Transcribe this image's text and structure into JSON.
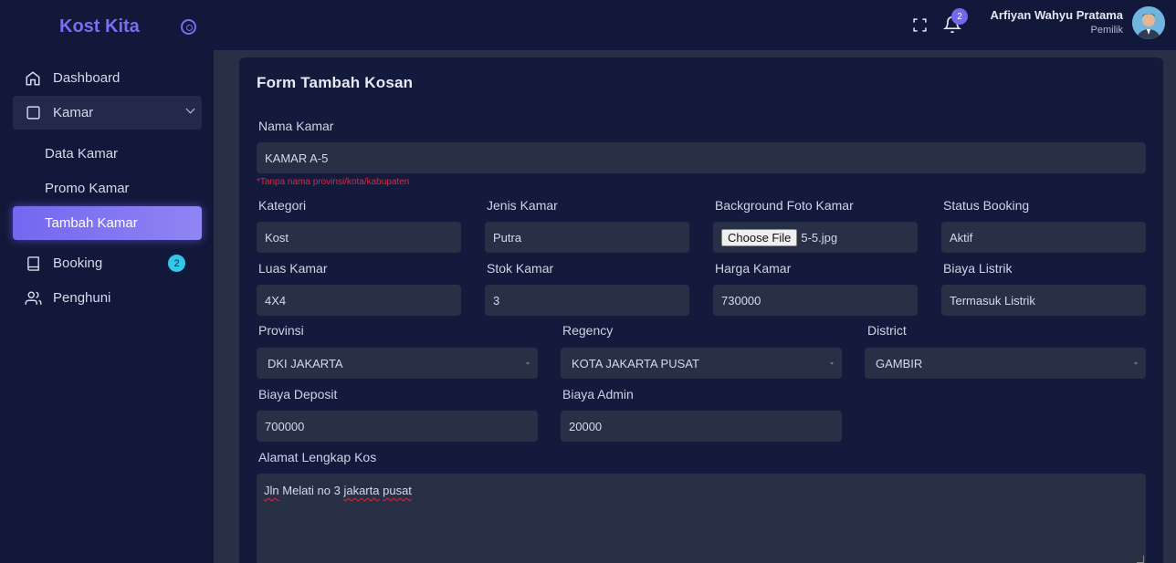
{
  "brand": {
    "name": "Kost Kita"
  },
  "sidebar": {
    "items": [
      {
        "label": "Dashboard",
        "icon": "home-icon"
      },
      {
        "label": "Kamar",
        "icon": "square-icon"
      },
      {
        "label": "Data Kamar"
      },
      {
        "label": "Promo Kamar"
      },
      {
        "label": "Tambah Kamar"
      },
      {
        "label": "Booking",
        "icon": "book-icon",
        "badge": "2"
      },
      {
        "label": "Penghuni",
        "icon": "users-icon"
      }
    ]
  },
  "header": {
    "notifications": "2",
    "user_name": "Arfiyan Wahyu Pratama",
    "user_role": "Pemilik"
  },
  "form": {
    "title": "Form Tambah Kosan",
    "nama_kamar": {
      "label": "Nama Kamar",
      "value": "KAMAR A-5",
      "hint": "*Tanpa nama provinsi/kota/kabupaten"
    },
    "kategori": {
      "label": "Kategori",
      "value": "Kost"
    },
    "jenis_kamar": {
      "label": "Jenis Kamar",
      "value": "Putra"
    },
    "background_foto": {
      "label": "Background Foto Kamar",
      "button": "Choose File",
      "file": "5-5.jpg"
    },
    "status_booking": {
      "label": "Status Booking",
      "value": "Aktif"
    },
    "luas_kamar": {
      "label": "Luas Kamar",
      "value": "4X4"
    },
    "stok_kamar": {
      "label": "Stok Kamar",
      "value": "3"
    },
    "harga_kamar": {
      "label": "Harga Kamar",
      "value": "730000"
    },
    "biaya_listrik": {
      "label": "Biaya Listrik",
      "value": "Termasuk Listrik"
    },
    "provinsi": {
      "label": "Provinsi",
      "value": "DKI JAKARTA"
    },
    "regency": {
      "label": "Regency",
      "value": "KOTA JAKARTA PUSAT"
    },
    "district": {
      "label": "District",
      "value": "GAMBIR"
    },
    "biaya_deposit": {
      "label": "Biaya Deposit",
      "value": "700000"
    },
    "biaya_admin": {
      "label": "Biaya Admin",
      "value": "20000"
    },
    "alamat": {
      "label": "Alamat Lengkap Kos",
      "word1": "Jln",
      "mid": " Melati no 3 ",
      "word2": "jakarta",
      "sp": " ",
      "word3": "pusat"
    }
  },
  "colors": {
    "accent": "#7367f0",
    "background": "#111738",
    "input": "#283046",
    "error": "#e0263f",
    "badge": "#32c8ea"
  }
}
